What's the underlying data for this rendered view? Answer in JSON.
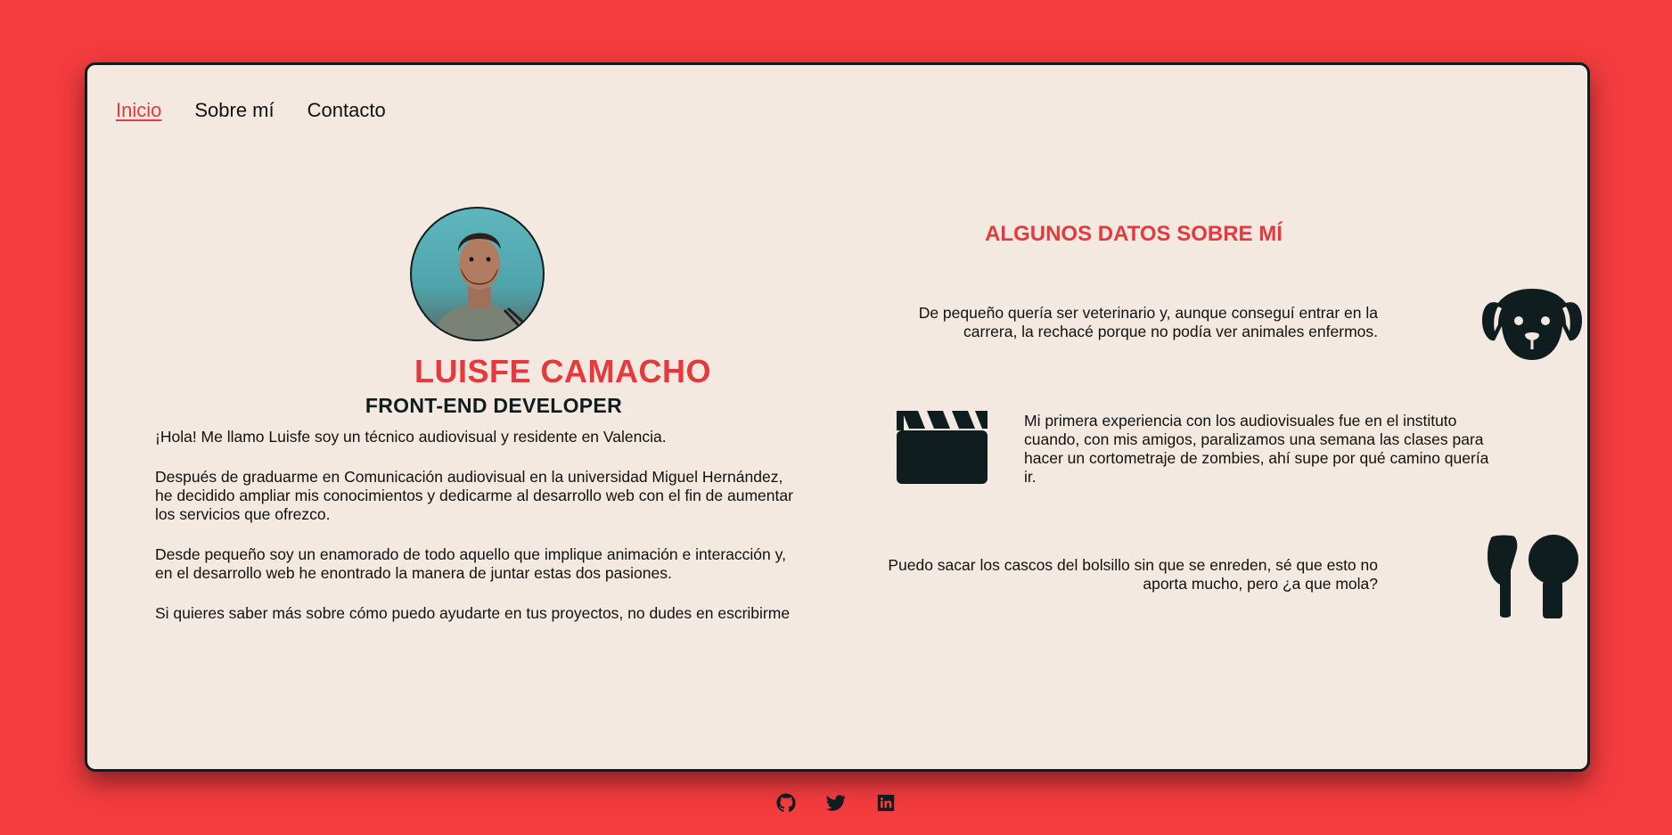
{
  "nav": {
    "items": [
      {
        "label": "Inicio",
        "active": true
      },
      {
        "label": "Sobre mí",
        "active": false
      },
      {
        "label": "Contacto",
        "active": false
      }
    ]
  },
  "profile": {
    "name": "LUISFE CAMACHO",
    "role": "FRONT-END DEVELOPER",
    "bio": [
      "¡Hola! Me llamo Luisfe soy un técnico audiovisual y residente en Valencia.",
      "Después de graduarme en Comunicación audiovisual en la universidad Miguel Hernández, he decidido ampliar mis conocimientos y dedicarme al desarrollo web con el fin de aumentar los servicios que ofrezco.",
      "Desde pequeño soy un enamorado de todo aquello que implique animación e interacción y, en el desarrollo web he enontrado la manera de juntar estas dos pasiones.",
      "Si quieres saber más sobre cómo puedo ayudarte en tus proyectos, no dudes en escribirme"
    ]
  },
  "facts": {
    "title": "ALGUNOS DATOS SOBRE MÍ",
    "items": [
      {
        "text": "De pequeño quería ser veterinario y, aunque conseguí entrar en la carrera, la rechacé porque no podía ver animales enfermos.",
        "icon": "dog-icon"
      },
      {
        "text": "Mi primera experiencia con los audiovisuales fue en el instituto cuando, con mis amigos, paralizamos una semana las clases para hacer un cortometraje de zombies, ahí supe por qué camino quería ir.",
        "icon": "clapperboard-icon"
      },
      {
        "text": "Puedo sacar los cascos del bolsillo sin que se enreden, sé que esto no aporta mucho, pero ¿a que mola?",
        "icon": "earbuds-icon"
      }
    ]
  },
  "footer": {
    "links": [
      "github-icon",
      "twitter-icon",
      "linkedin-icon"
    ]
  },
  "colors": {
    "background": "#f43c3f",
    "card": "#f3e9e1",
    "accent": "#e5393d",
    "dark": "#0f1d1f"
  }
}
